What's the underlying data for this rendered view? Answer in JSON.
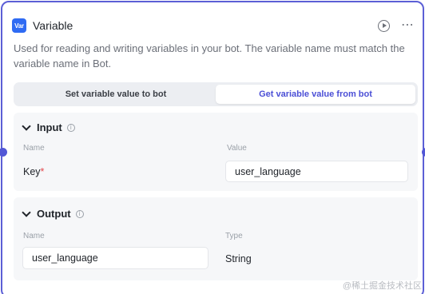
{
  "node": {
    "badge": "Var",
    "title": "Variable",
    "description": "Used for reading and writing variables in your bot. The variable name must match the variable name in Bot."
  },
  "tabs": [
    {
      "label": "Set variable value to bot",
      "active": false
    },
    {
      "label": "Get variable value from bot",
      "active": true
    }
  ],
  "input": {
    "title": "Input",
    "col_name": "Name",
    "col_value": "Value",
    "name": "Key",
    "required_mark": "*",
    "value": "user_language"
  },
  "output": {
    "title": "Output",
    "col_name": "Name",
    "col_type": "Type",
    "name": "user_language",
    "type": "String"
  },
  "watermark": "@稀土掘金技术社区",
  "colors": {
    "accent": "#4b4fd6",
    "border": "#5c5fd6",
    "badge": "#2f6bf3",
    "required": "#e5484d"
  }
}
